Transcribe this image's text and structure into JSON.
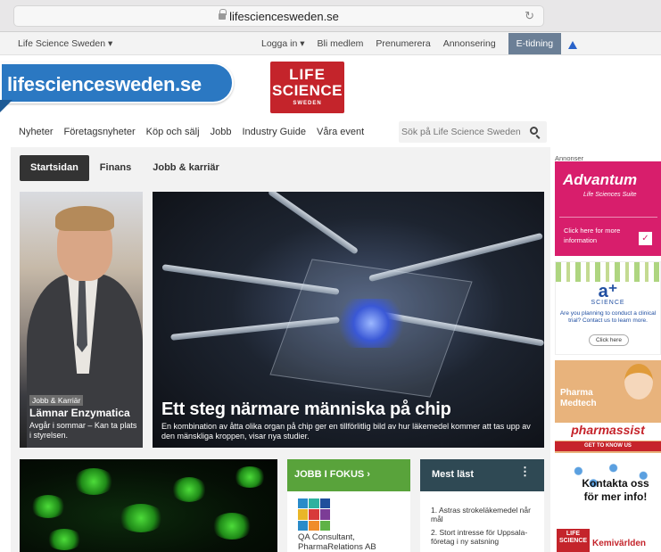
{
  "browser": {
    "url": "lifesciencesweden.se",
    "reload_icon": "reload-icon"
  },
  "utility": {
    "site_selector": "Life Science Sweden ▾",
    "login": "Logga in ▾",
    "join": "Bli medlem",
    "subscribe": "Prenumerera",
    "advertising": "Annonsering",
    "etidning": "E-tidning"
  },
  "banner": {
    "domain": "lifesciencesweden.se"
  },
  "logo": {
    "line1": "LIFE",
    "line2": "SCIENCE",
    "line3": "SWEDEN"
  },
  "nav": {
    "items": [
      "Nyheter",
      "Företagsnyheter",
      "Köp och sälj",
      "Jobb",
      "Industry Guide",
      "Våra event"
    ],
    "search_placeholder": "Sök på Life Science Sweden"
  },
  "subtabs": [
    "Startsidan",
    "Finans",
    "Jobb & karriär"
  ],
  "hero_left": {
    "tag": "Jobb & Karriär",
    "title": "Lämnar Enzymatica",
    "subtitle": "Avgår i sommar – Kan ta plats i styrelsen."
  },
  "hero_main": {
    "title": "Ett steg närmare människa på chip",
    "subtitle": "En kombination av åtta olika organ på chip ger en tillförlitlig bild av hur läkemedel kommer att tas upp av den mänskliga kroppen, visar nya studier."
  },
  "jobb_fokus": {
    "heading": "JOBB I FOKUS ›",
    "text": "QA Consultant, PharmaRelations AB",
    "colors": [
      "#2a8bc9",
      "#2fb2a0",
      "#1f4f9c",
      "#e9b628",
      "#d83a3a",
      "#7c3c96",
      "#2a8bc9",
      "#f08c2a",
      "#5fb246"
    ]
  },
  "mest_last": {
    "heading": "Mest läst",
    "items": [
      "1. Astras strokeläkemedel når mål",
      "2. Stort intresse för Uppsala-företag i ny satsning"
    ]
  },
  "ads": {
    "label": "Annonser",
    "advantum": {
      "title": "Advantum",
      "sub": "Life Sciences Suite",
      "cta": "Click here for more information",
      "check": "✓"
    },
    "ascience": {
      "logo": "a⁺",
      "science": "SCIENCE",
      "text": "Are you planning to conduct a clinical trial? Contact us to learn more.",
      "button": "Click here"
    },
    "pharma": {
      "head1": "Pharma",
      "head2": "Medtech",
      "brand": "pharmassist",
      "foot": "GET TO KNOW US"
    },
    "kemi": {
      "text": "Kontakta oss för mer info!",
      "logo": "LIFE SCIENCE",
      "brand": "Kemivärlden"
    }
  }
}
